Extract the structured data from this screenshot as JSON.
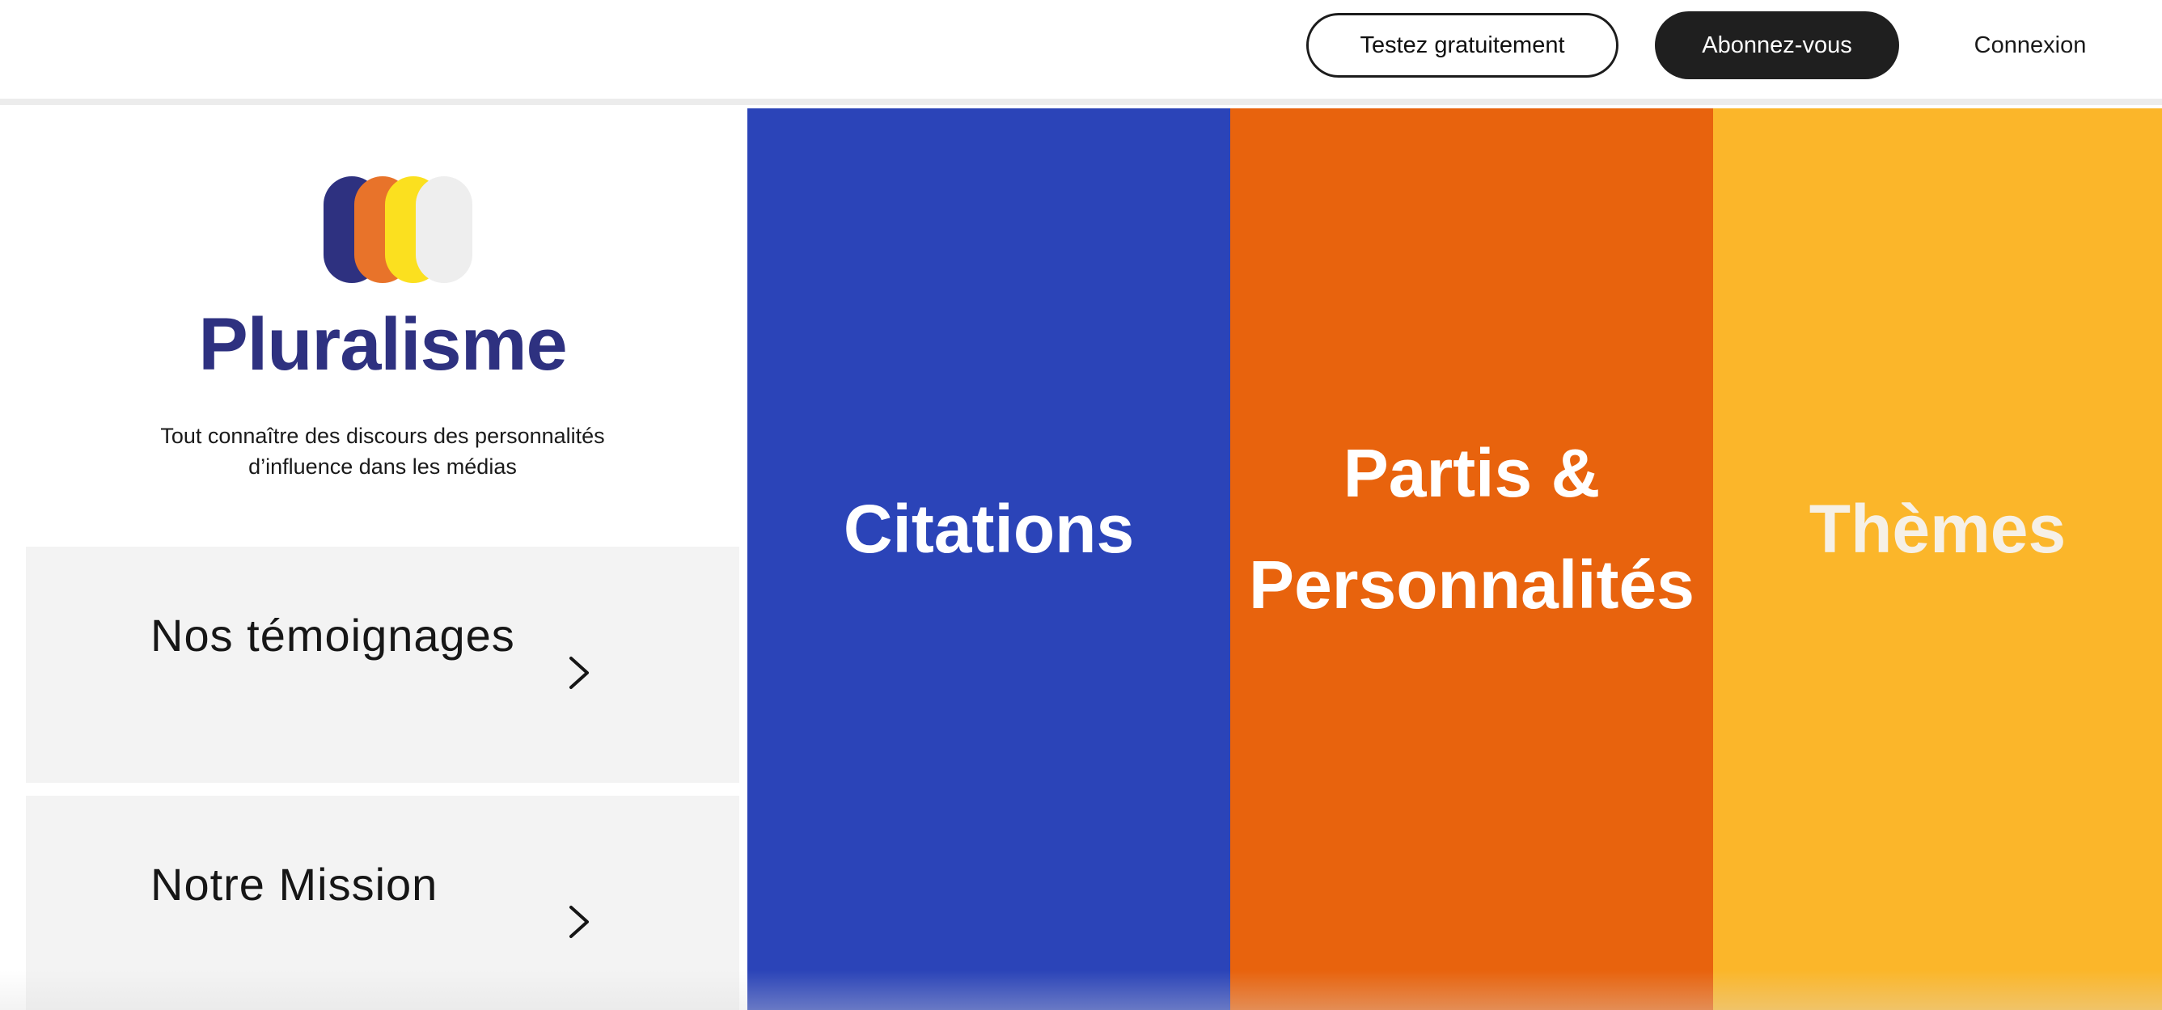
{
  "header": {
    "trial_label": "Testez gratuitement",
    "subscribe_label": "Abonnez-vous",
    "login_label": "Connexion"
  },
  "brand": {
    "title": "Pluralisme",
    "tagline": "Tout connaître des discours des personnalités d’influence dans les médias",
    "logo_colors": [
      "#2e3180",
      "#e8732a",
      "#fbe01f",
      "#eeeeee"
    ]
  },
  "menu": {
    "items": [
      {
        "label": "Nos témoignages",
        "icon": "chevron-right-icon"
      },
      {
        "label": "Notre Mission",
        "icon": "chevron-right-icon"
      }
    ]
  },
  "categories": [
    {
      "label": "Citations",
      "color": "#2b44b8"
    },
    {
      "label": "Partis & Personnalités",
      "color": "#e8630d"
    },
    {
      "label": "Thèmes",
      "color": "#fbb62a"
    }
  ]
}
